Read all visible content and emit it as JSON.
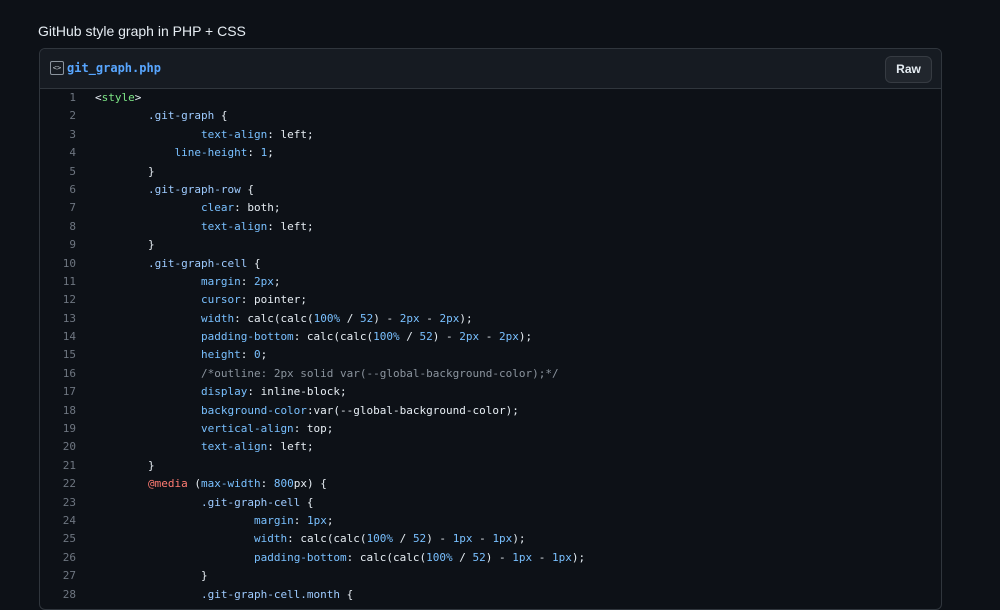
{
  "page_title": "GitHub style graph in PHP + CSS",
  "file": {
    "icon": "code-file-icon",
    "icon_glyph": "<>",
    "name": "git_graph.php",
    "raw_label": "Raw"
  },
  "colors": {
    "background": "#0d1117",
    "header": "#161b22",
    "border": "#30363d",
    "link": "#58a6ff"
  },
  "lines": [
    [
      [
        "<",
        "val"
      ],
      [
        "style",
        "tag"
      ],
      [
        ">",
        "val"
      ]
    ],
    [
      [
        "\t.git-graph",
        "sel"
      ],
      [
        " {",
        "val"
      ]
    ],
    [
      [
        "\t\ttext-align",
        "prop"
      ],
      [
        ": left;",
        "val"
      ]
    ],
    [
      [
        "\t    line-height",
        "prop"
      ],
      [
        ": ",
        "val"
      ],
      [
        "1",
        "num"
      ],
      [
        ";",
        "val"
      ]
    ],
    [
      [
        "\t}",
        "val"
      ]
    ],
    [
      [
        "\t.git-graph-row",
        "sel"
      ],
      [
        " {",
        "val"
      ]
    ],
    [
      [
        "\t\tclear",
        "prop"
      ],
      [
        ": both;",
        "val"
      ]
    ],
    [
      [
        "\t\ttext-align",
        "prop"
      ],
      [
        ": left;",
        "val"
      ]
    ],
    [
      [
        "\t}",
        "val"
      ]
    ],
    [
      [
        "\t.git-graph-cell",
        "sel"
      ],
      [
        " {",
        "val"
      ]
    ],
    [
      [
        "\t\tmargin",
        "prop"
      ],
      [
        ": ",
        "val"
      ],
      [
        "2px",
        "num"
      ],
      [
        ";",
        "val"
      ]
    ],
    [
      [
        "\t\tcursor",
        "prop"
      ],
      [
        ": pointer;",
        "val"
      ]
    ],
    [
      [
        "\t\twidth",
        "prop"
      ],
      [
        ": calc(calc(",
        "val"
      ],
      [
        "100%",
        "num"
      ],
      [
        " / ",
        "val"
      ],
      [
        "52",
        "num"
      ],
      [
        ") - ",
        "val"
      ],
      [
        "2px",
        "num"
      ],
      [
        " - ",
        "val"
      ],
      [
        "2px",
        "num"
      ],
      [
        ");",
        "val"
      ]
    ],
    [
      [
        "\t\tpadding-bottom",
        "prop"
      ],
      [
        ": calc(calc(",
        "val"
      ],
      [
        "100%",
        "num"
      ],
      [
        " / ",
        "val"
      ],
      [
        "52",
        "num"
      ],
      [
        ") - ",
        "val"
      ],
      [
        "2px",
        "num"
      ],
      [
        " - ",
        "val"
      ],
      [
        "2px",
        "num"
      ],
      [
        ");",
        "val"
      ]
    ],
    [
      [
        "\t\theight",
        "prop"
      ],
      [
        ": ",
        "val"
      ],
      [
        "0",
        "num"
      ],
      [
        ";",
        "val"
      ]
    ],
    [
      [
        "\t\t/*outline: 2px solid var(--global-background-color);*/",
        "com"
      ]
    ],
    [
      [
        "\t\tdisplay",
        "prop"
      ],
      [
        ": inline-block;",
        "val"
      ]
    ],
    [
      [
        "\t\tbackground-color",
        "prop"
      ],
      [
        ":var(--global-background-color);",
        "val"
      ]
    ],
    [
      [
        "\t\tvertical-align",
        "prop"
      ],
      [
        ": top;",
        "val"
      ]
    ],
    [
      [
        "\t\ttext-align",
        "prop"
      ],
      [
        ": left;",
        "val"
      ]
    ],
    [
      [
        "\t}",
        "val"
      ]
    ],
    [
      [
        "\t",
        "val"
      ],
      [
        "@media",
        "at"
      ],
      [
        " (",
        "val"
      ],
      [
        "max-width",
        "prop"
      ],
      [
        ": ",
        "val"
      ],
      [
        "800",
        "num"
      ],
      [
        "px) {",
        "val"
      ]
    ],
    [
      [
        "\t\t.git-graph-cell",
        "sel"
      ],
      [
        " {",
        "val"
      ]
    ],
    [
      [
        "\t\t\tmargin",
        "prop"
      ],
      [
        ": ",
        "val"
      ],
      [
        "1px",
        "num"
      ],
      [
        ";",
        "val"
      ]
    ],
    [
      [
        "\t\t\twidth",
        "prop"
      ],
      [
        ": calc(calc(",
        "val"
      ],
      [
        "100%",
        "num"
      ],
      [
        " / ",
        "val"
      ],
      [
        "52",
        "num"
      ],
      [
        ") - ",
        "val"
      ],
      [
        "1px",
        "num"
      ],
      [
        " - ",
        "val"
      ],
      [
        "1px",
        "num"
      ],
      [
        ");",
        "val"
      ]
    ],
    [
      [
        "\t\t\tpadding-bottom",
        "prop"
      ],
      [
        ": calc(calc(",
        "val"
      ],
      [
        "100%",
        "num"
      ],
      [
        " / ",
        "val"
      ],
      [
        "52",
        "num"
      ],
      [
        ") - ",
        "val"
      ],
      [
        "1px",
        "num"
      ],
      [
        " - ",
        "val"
      ],
      [
        "1px",
        "num"
      ],
      [
        ");",
        "val"
      ]
    ],
    [
      [
        "\t\t}",
        "val"
      ]
    ],
    [
      [
        "\t\t.git-graph-cell.month",
        "sel"
      ],
      [
        " {",
        "val"
      ]
    ]
  ]
}
